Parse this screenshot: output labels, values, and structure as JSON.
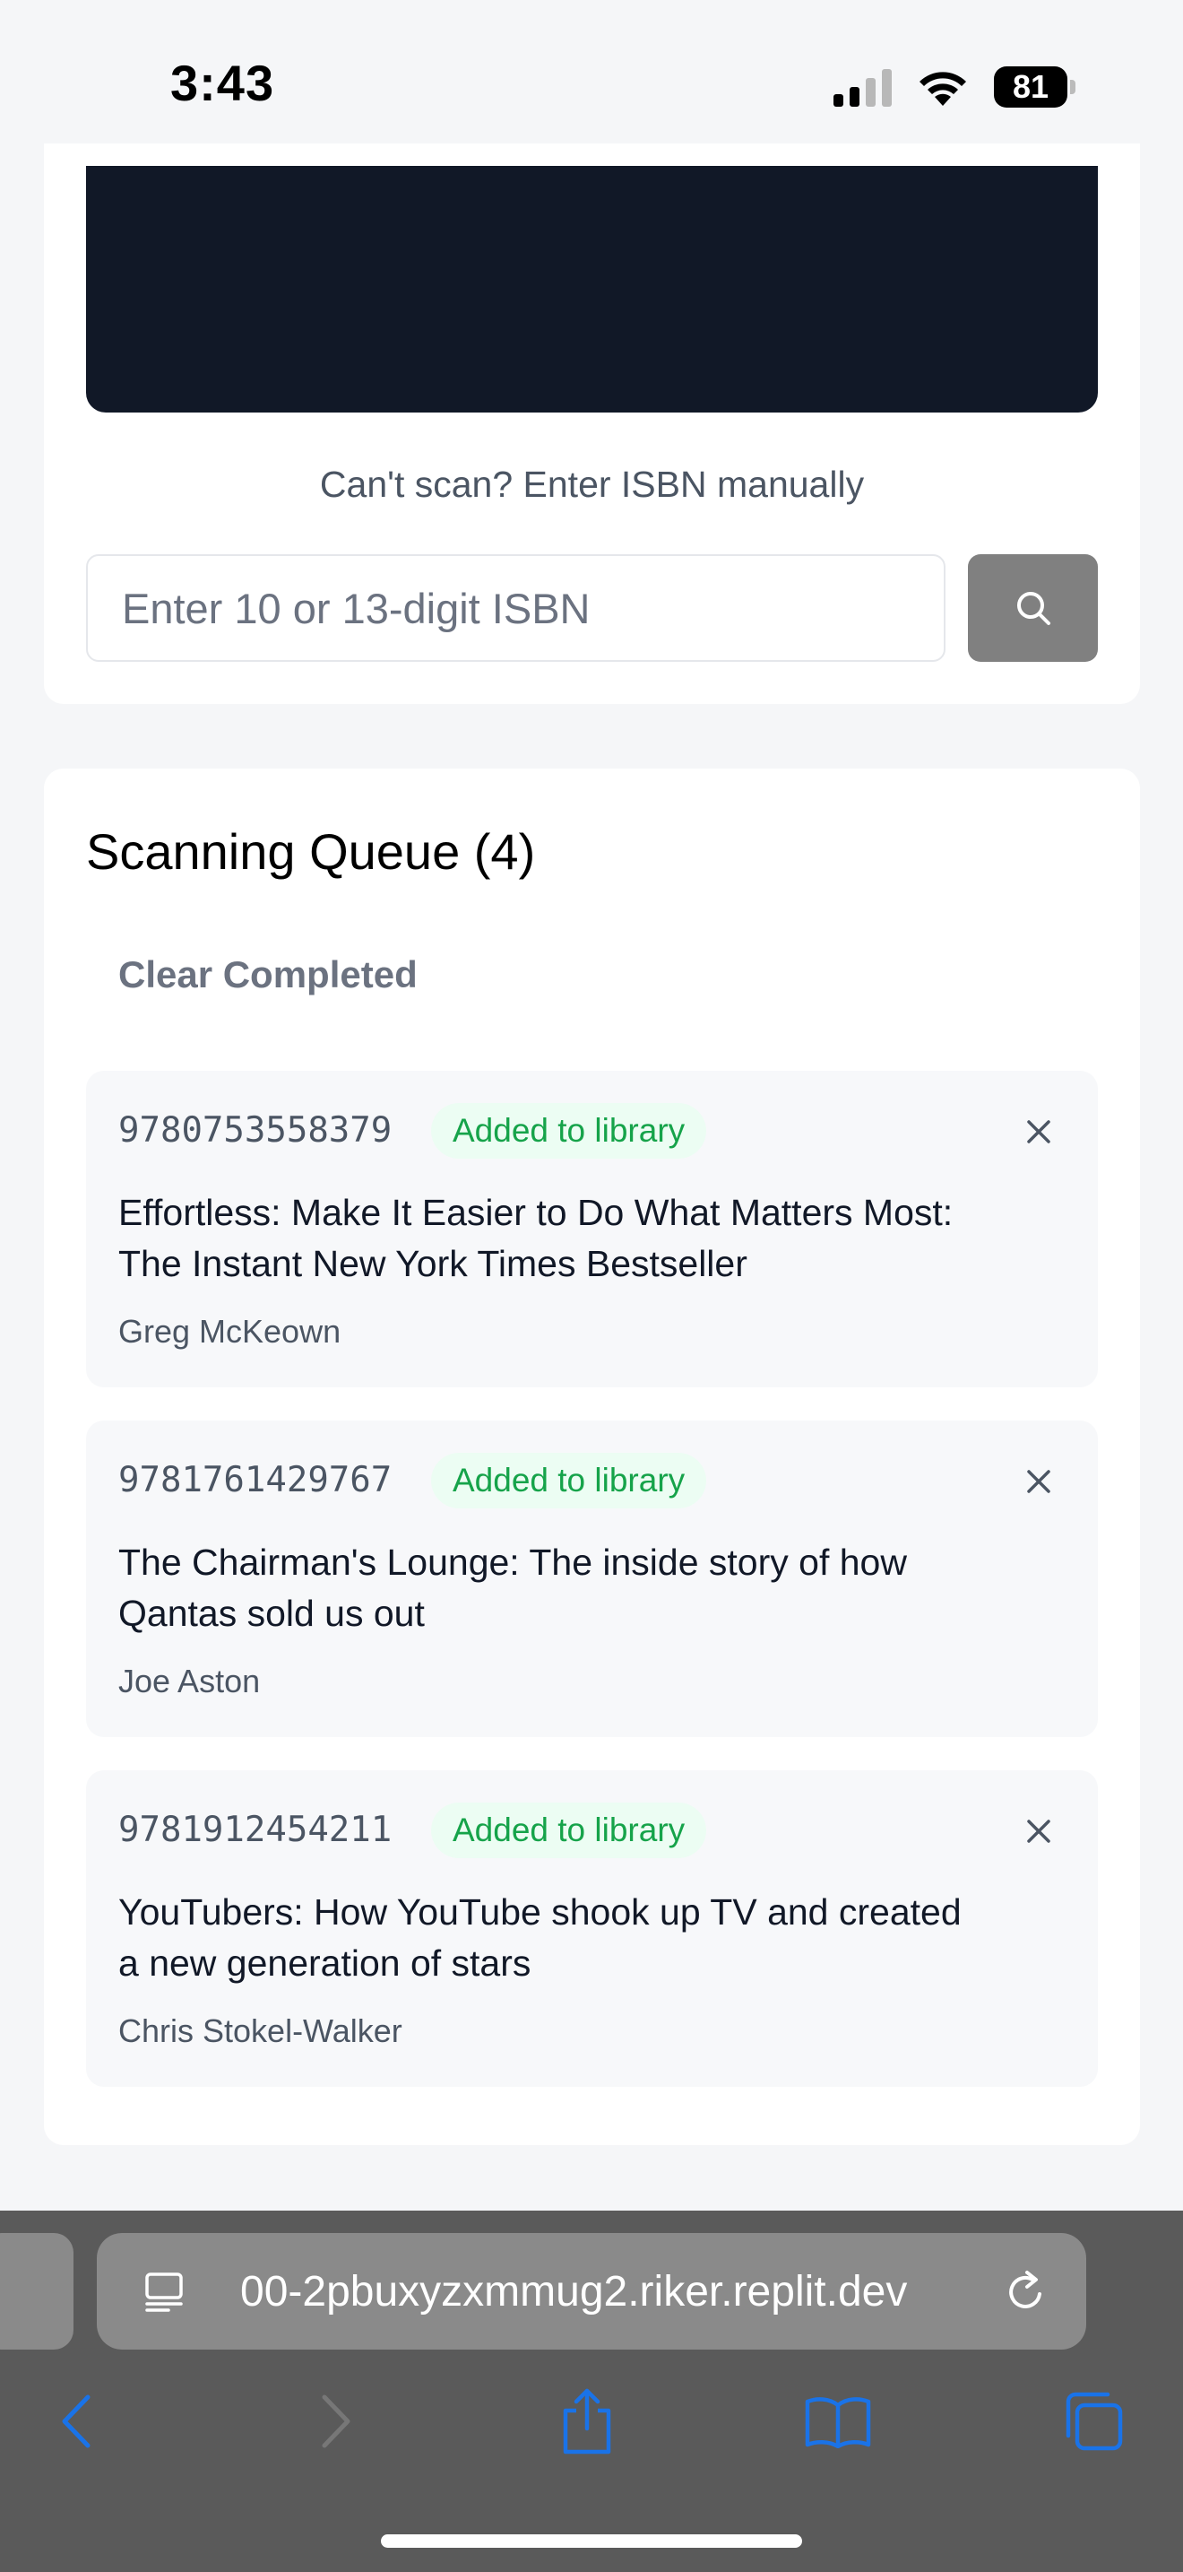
{
  "status_bar": {
    "time": "3:43",
    "battery": "81"
  },
  "scanner": {
    "manual_label": "Can't scan? Enter ISBN manually",
    "isbn_placeholder": "Enter 10 or 13-digit ISBN",
    "isbn_value": ""
  },
  "queue": {
    "title": "Scanning Queue (4)",
    "clear_label": "Clear Completed",
    "items": [
      {
        "isbn": "9780753558379",
        "status": "Added to library",
        "title": "Effortless: Make It Easier to Do What Matters Most: The Instant New York Times Bestseller",
        "author": "Greg McKeown"
      },
      {
        "isbn": "9781761429767",
        "status": "Added to library",
        "title": "The Chairman's Lounge: The inside story of how Qantas sold us out",
        "author": "Joe Aston"
      },
      {
        "isbn": "9781912454211",
        "status": "Added to library",
        "title": "YouTubers: How YouTube shook up TV and created a new generation of stars",
        "author": "Chris Stokel-Walker"
      }
    ]
  },
  "browser": {
    "url": "00-2pbuxyzxmmug2.riker.replit.dev"
  },
  "colors": {
    "camera_bg": "#111827",
    "status_green": "#16a34a",
    "status_green_bg": "#ecfdf3",
    "search_button": "#808080",
    "browser_accent": "#1a73e8"
  }
}
